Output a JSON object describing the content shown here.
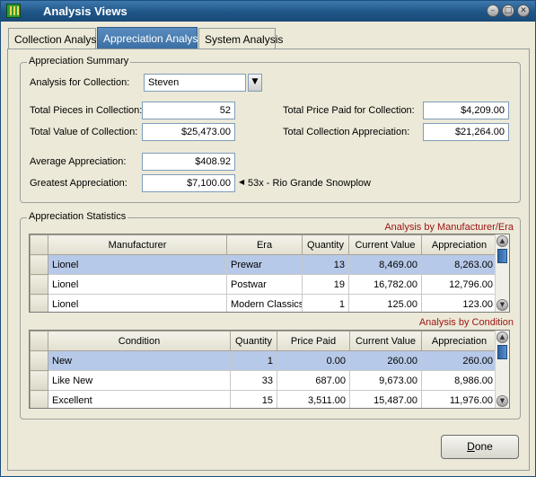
{
  "window": {
    "title": "Analysis Views"
  },
  "tabs": [
    {
      "label": "Collection Analysis",
      "active": false
    },
    {
      "label": "Appreciation Analysis",
      "active": true
    },
    {
      "label": "System Analysis",
      "active": false
    }
  ],
  "summary": {
    "group_title": "Appreciation Summary",
    "collection_label": "Analysis for Collection:",
    "collection_value": "Steven",
    "total_pieces_label": "Total Pieces in Collection:",
    "total_pieces_value": "52",
    "total_value_label": "Total Value of Collection:",
    "total_value_value": "$25,473.00",
    "total_price_label": "Total Price Paid for Collection:",
    "total_price_value": "$4,209.00",
    "total_appreciation_label": "Total Collection Appreciation:",
    "total_appreciation_value": "$21,264.00",
    "average_label": "Average Appreciation:",
    "average_value": "$408.92",
    "greatest_label": "Greatest Appreciation:",
    "greatest_value": "$7,100.00",
    "greatest_note": "53x - Rio Grande Snowplow"
  },
  "statistics": {
    "group_title": "Appreciation Statistics",
    "manufacturer_caption": "Analysis by Manufacturer/Era",
    "manufacturer_headers": [
      "Manufacturer",
      "Era",
      "Quantity",
      "Current Value",
      "Appreciation"
    ],
    "manufacturer_rows": [
      {
        "manufacturer": "Lionel",
        "era": "Prewar",
        "quantity": "13",
        "current_value": "8,469.00",
        "appreciation": "8,263.00"
      },
      {
        "manufacturer": "Lionel",
        "era": "Postwar",
        "quantity": "19",
        "current_value": "16,782.00",
        "appreciation": "12,796.00"
      },
      {
        "manufacturer": "Lionel",
        "era": "Modern Classics",
        "quantity": "1",
        "current_value": "125.00",
        "appreciation": "123.00"
      }
    ],
    "condition_caption": "Analysis by Condition",
    "condition_headers": [
      "Condition",
      "Quantity",
      "Price Paid",
      "Current Value",
      "Appreciation"
    ],
    "condition_rows": [
      {
        "condition": "New",
        "quantity": "1",
        "price_paid": "0.00",
        "current_value": "260.00",
        "appreciation": "260.00"
      },
      {
        "condition": "Like New",
        "quantity": "33",
        "price_paid": "687.00",
        "current_value": "9,673.00",
        "appreciation": "8,986.00"
      },
      {
        "condition": "Excellent",
        "quantity": "15",
        "price_paid": "3,511.00",
        "current_value": "15,487.00",
        "appreciation": "11,976.00"
      }
    ]
  },
  "done_button": {
    "label_underlined": "D",
    "label_rest": "one"
  }
}
